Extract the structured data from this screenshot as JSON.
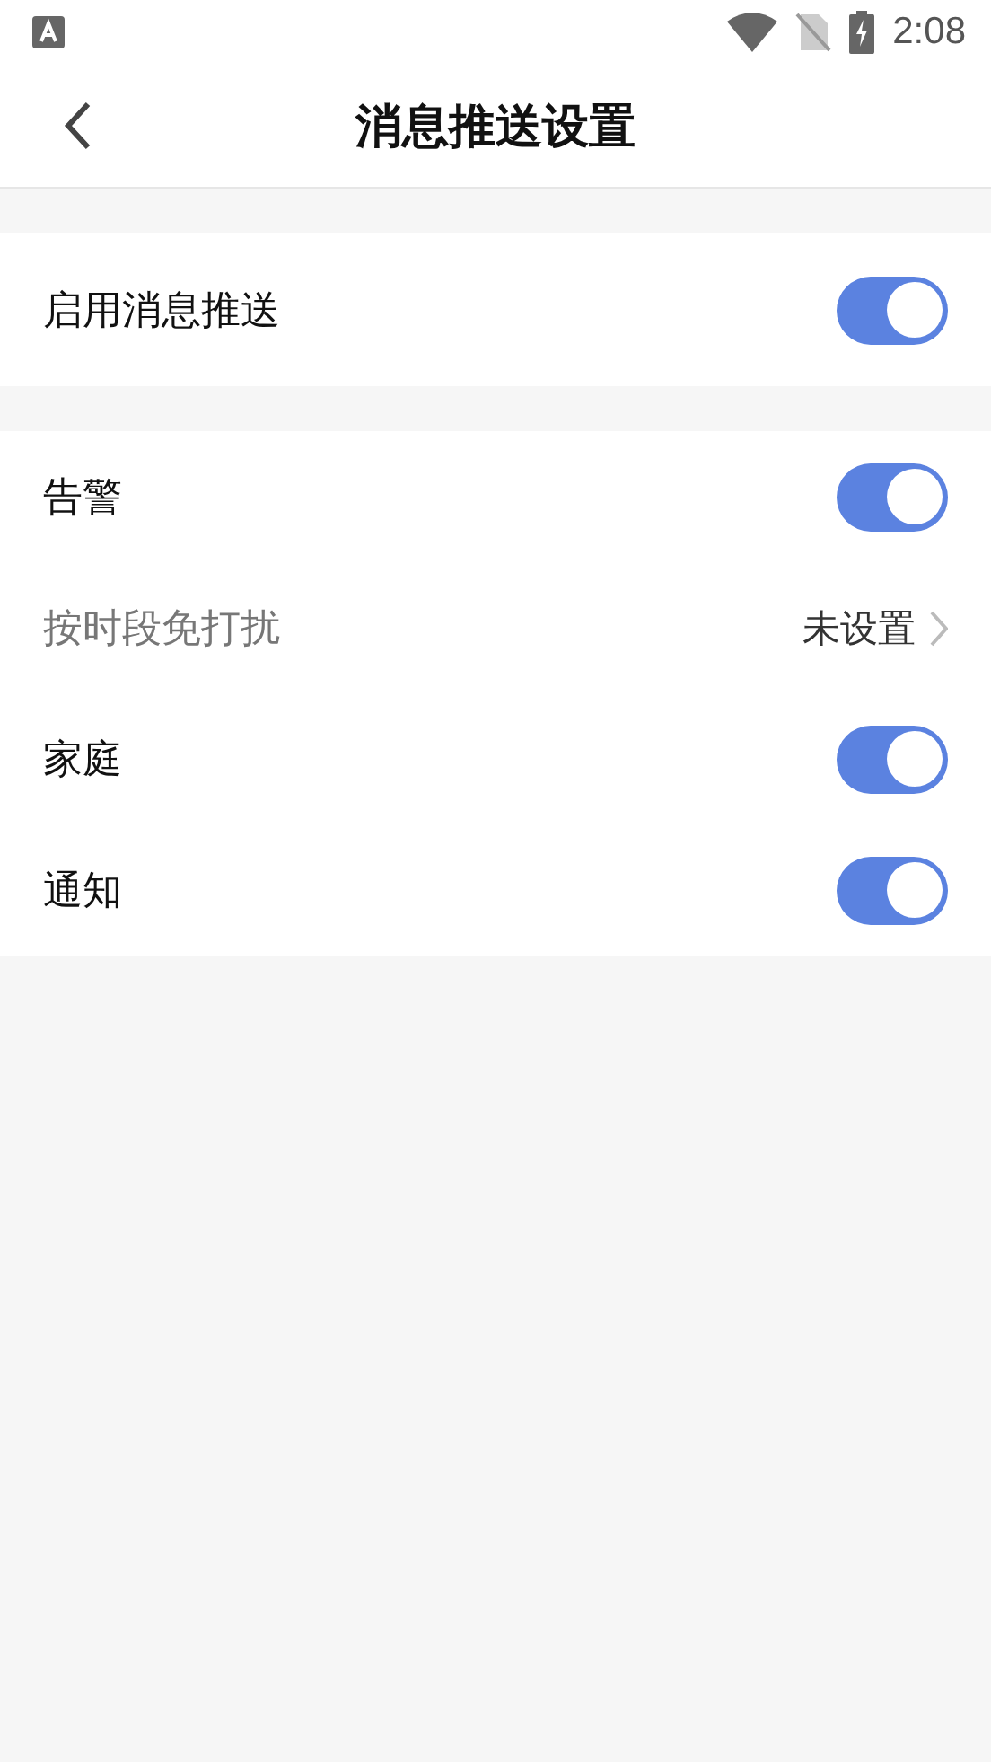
{
  "status_bar": {
    "time": "2:08"
  },
  "header": {
    "title": "消息推送设置"
  },
  "sections": [
    {
      "rows": [
        {
          "kind": "toggle",
          "label": "启用消息推送",
          "on": true
        }
      ]
    },
    {
      "rows": [
        {
          "kind": "toggle",
          "label": "告警",
          "on": true
        },
        {
          "kind": "link",
          "label": "按时段免打扰",
          "value": "未设置"
        },
        {
          "kind": "toggle",
          "label": "家庭",
          "on": true
        },
        {
          "kind": "toggle",
          "label": "通知",
          "on": true
        }
      ]
    }
  ]
}
